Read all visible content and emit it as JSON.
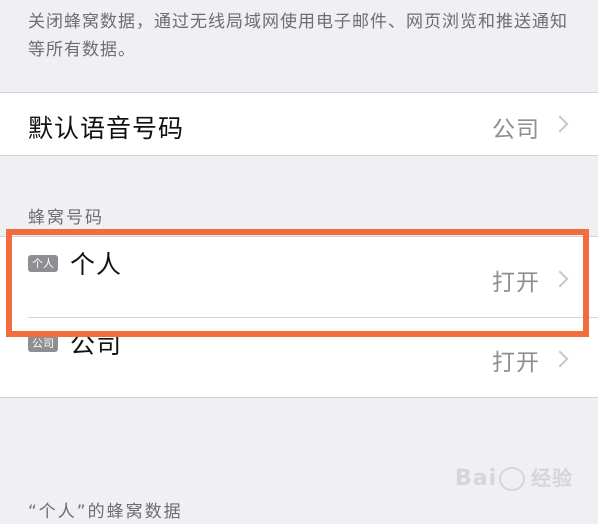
{
  "cellular_data_footer": "关闭蜂窝数据，通过无线局域网使用电子邮件、网页浏览和推送通知等所有数据。",
  "default_voice_line": {
    "label": "默认语音号码",
    "value": "公司"
  },
  "cellular_plans": {
    "header": "蜂窝号码",
    "items": [
      {
        "badge": "个人",
        "label": "个人",
        "status": "打开"
      },
      {
        "badge": "公司",
        "label": "公司",
        "status": "打开"
      }
    ]
  },
  "personal_cellular_data_header": "“个人”的蜂窝数据",
  "watermark": {
    "left": "Bai",
    "right": "经验"
  },
  "colors": {
    "background": "#efeff4",
    "highlight": "#f26d3d",
    "secondary_text": "#8e8e93"
  },
  "icons": [
    "chevron-right-icon",
    "baidu-paw-icon"
  ]
}
